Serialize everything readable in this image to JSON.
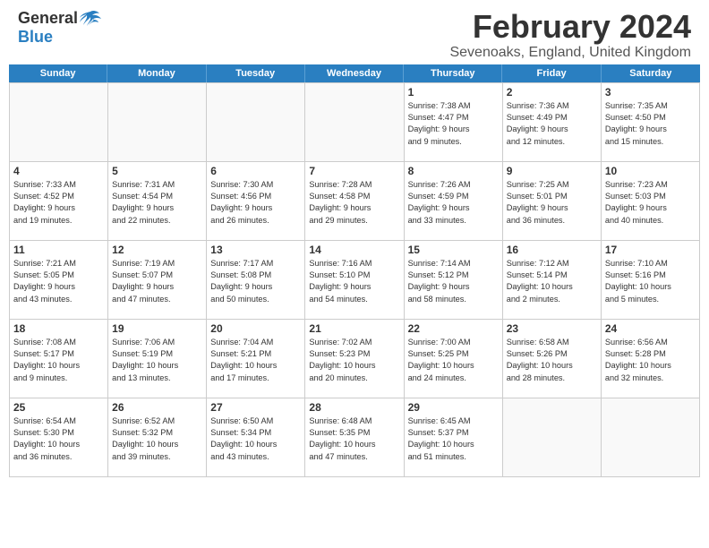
{
  "header": {
    "logo_general": "General",
    "logo_blue": "Blue",
    "month_title": "February 2024",
    "location": "Sevenoaks, England, United Kingdom"
  },
  "days_of_week": [
    "Sunday",
    "Monday",
    "Tuesday",
    "Wednesday",
    "Thursday",
    "Friday",
    "Saturday"
  ],
  "weeks": [
    [
      {
        "day": "",
        "info": ""
      },
      {
        "day": "",
        "info": ""
      },
      {
        "day": "",
        "info": ""
      },
      {
        "day": "",
        "info": ""
      },
      {
        "day": "1",
        "info": "Sunrise: 7:38 AM\nSunset: 4:47 PM\nDaylight: 9 hours\nand 9 minutes."
      },
      {
        "day": "2",
        "info": "Sunrise: 7:36 AM\nSunset: 4:49 PM\nDaylight: 9 hours\nand 12 minutes."
      },
      {
        "day": "3",
        "info": "Sunrise: 7:35 AM\nSunset: 4:50 PM\nDaylight: 9 hours\nand 15 minutes."
      }
    ],
    [
      {
        "day": "4",
        "info": "Sunrise: 7:33 AM\nSunset: 4:52 PM\nDaylight: 9 hours\nand 19 minutes."
      },
      {
        "day": "5",
        "info": "Sunrise: 7:31 AM\nSunset: 4:54 PM\nDaylight: 9 hours\nand 22 minutes."
      },
      {
        "day": "6",
        "info": "Sunrise: 7:30 AM\nSunset: 4:56 PM\nDaylight: 9 hours\nand 26 minutes."
      },
      {
        "day": "7",
        "info": "Sunrise: 7:28 AM\nSunset: 4:58 PM\nDaylight: 9 hours\nand 29 minutes."
      },
      {
        "day": "8",
        "info": "Sunrise: 7:26 AM\nSunset: 4:59 PM\nDaylight: 9 hours\nand 33 minutes."
      },
      {
        "day": "9",
        "info": "Sunrise: 7:25 AM\nSunset: 5:01 PM\nDaylight: 9 hours\nand 36 minutes."
      },
      {
        "day": "10",
        "info": "Sunrise: 7:23 AM\nSunset: 5:03 PM\nDaylight: 9 hours\nand 40 minutes."
      }
    ],
    [
      {
        "day": "11",
        "info": "Sunrise: 7:21 AM\nSunset: 5:05 PM\nDaylight: 9 hours\nand 43 minutes."
      },
      {
        "day": "12",
        "info": "Sunrise: 7:19 AM\nSunset: 5:07 PM\nDaylight: 9 hours\nand 47 minutes."
      },
      {
        "day": "13",
        "info": "Sunrise: 7:17 AM\nSunset: 5:08 PM\nDaylight: 9 hours\nand 50 minutes."
      },
      {
        "day": "14",
        "info": "Sunrise: 7:16 AM\nSunset: 5:10 PM\nDaylight: 9 hours\nand 54 minutes."
      },
      {
        "day": "15",
        "info": "Sunrise: 7:14 AM\nSunset: 5:12 PM\nDaylight: 9 hours\nand 58 minutes."
      },
      {
        "day": "16",
        "info": "Sunrise: 7:12 AM\nSunset: 5:14 PM\nDaylight: 10 hours\nand 2 minutes."
      },
      {
        "day": "17",
        "info": "Sunrise: 7:10 AM\nSunset: 5:16 PM\nDaylight: 10 hours\nand 5 minutes."
      }
    ],
    [
      {
        "day": "18",
        "info": "Sunrise: 7:08 AM\nSunset: 5:17 PM\nDaylight: 10 hours\nand 9 minutes."
      },
      {
        "day": "19",
        "info": "Sunrise: 7:06 AM\nSunset: 5:19 PM\nDaylight: 10 hours\nand 13 minutes."
      },
      {
        "day": "20",
        "info": "Sunrise: 7:04 AM\nSunset: 5:21 PM\nDaylight: 10 hours\nand 17 minutes."
      },
      {
        "day": "21",
        "info": "Sunrise: 7:02 AM\nSunset: 5:23 PM\nDaylight: 10 hours\nand 20 minutes."
      },
      {
        "day": "22",
        "info": "Sunrise: 7:00 AM\nSunset: 5:25 PM\nDaylight: 10 hours\nand 24 minutes."
      },
      {
        "day": "23",
        "info": "Sunrise: 6:58 AM\nSunset: 5:26 PM\nDaylight: 10 hours\nand 28 minutes."
      },
      {
        "day": "24",
        "info": "Sunrise: 6:56 AM\nSunset: 5:28 PM\nDaylight: 10 hours\nand 32 minutes."
      }
    ],
    [
      {
        "day": "25",
        "info": "Sunrise: 6:54 AM\nSunset: 5:30 PM\nDaylight: 10 hours\nand 36 minutes."
      },
      {
        "day": "26",
        "info": "Sunrise: 6:52 AM\nSunset: 5:32 PM\nDaylight: 10 hours\nand 39 minutes."
      },
      {
        "day": "27",
        "info": "Sunrise: 6:50 AM\nSunset: 5:34 PM\nDaylight: 10 hours\nand 43 minutes."
      },
      {
        "day": "28",
        "info": "Sunrise: 6:48 AM\nSunset: 5:35 PM\nDaylight: 10 hours\nand 47 minutes."
      },
      {
        "day": "29",
        "info": "Sunrise: 6:45 AM\nSunset: 5:37 PM\nDaylight: 10 hours\nand 51 minutes."
      },
      {
        "day": "",
        "info": ""
      },
      {
        "day": "",
        "info": ""
      }
    ]
  ]
}
